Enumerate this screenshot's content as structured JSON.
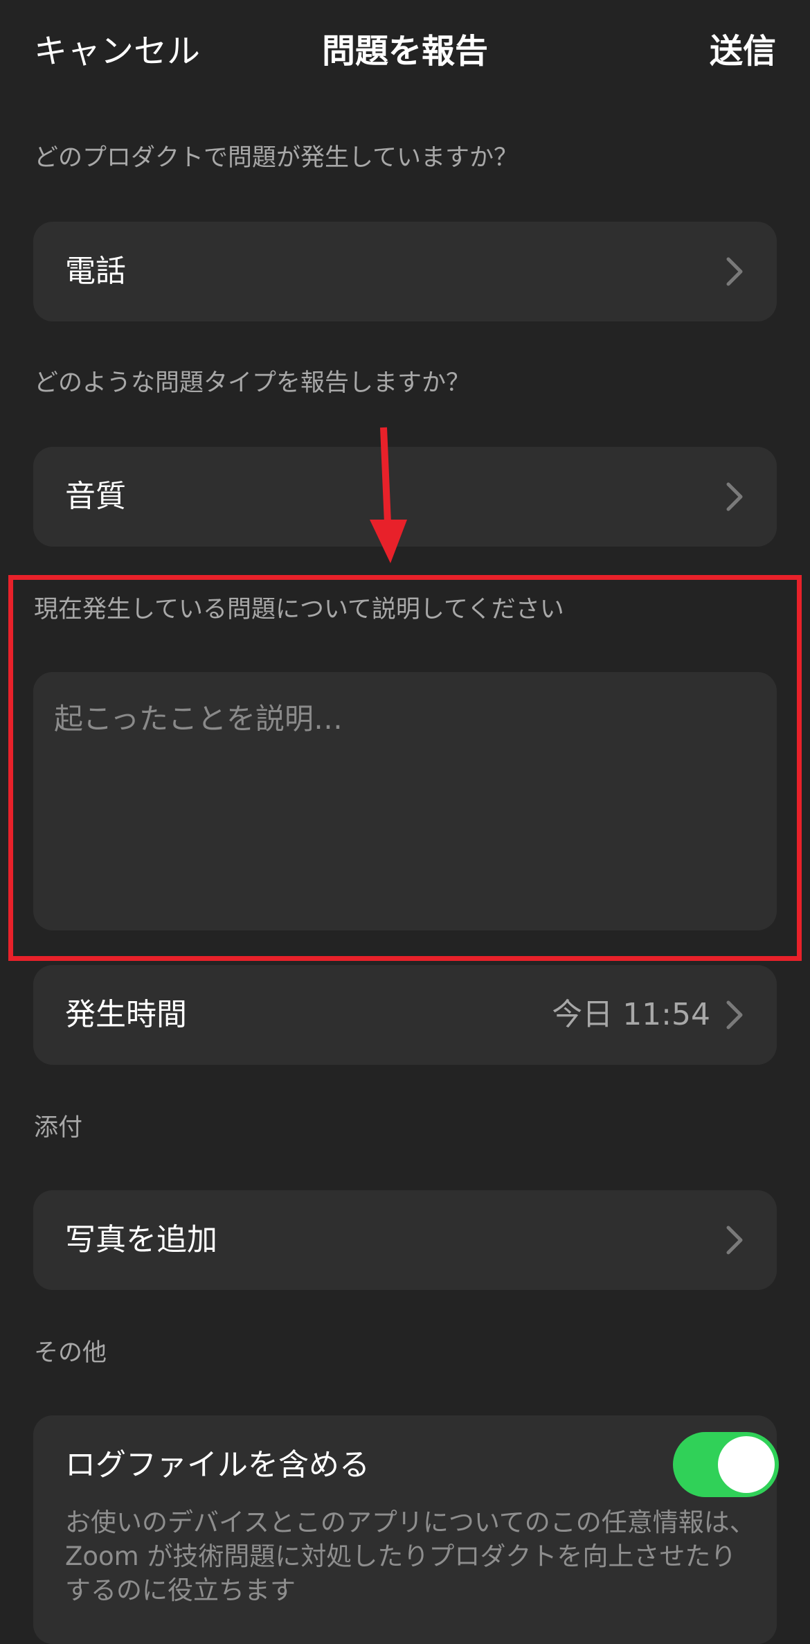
{
  "nav": {
    "cancel": "キャンセル",
    "title": "問題を報告",
    "send": "送信"
  },
  "product_section": {
    "label": "どのプロダクトで問題が発生していますか？",
    "value": "電話"
  },
  "issue_type_section": {
    "label": "どのような問題タイプを報告しますか？",
    "value": "音質"
  },
  "description_section": {
    "label": "現在発生している問題について説明してください",
    "placeholder": "起こったことを説明…"
  },
  "occurrence": {
    "label": "発生時間",
    "value": "今日 11:54"
  },
  "attachments": {
    "label": "添付",
    "add_photo": "写真を追加"
  },
  "other": {
    "label": "その他",
    "include_logs_label": "ログファイルを含める",
    "include_logs_enabled": true,
    "include_logs_desc": "お使いのデバイスとこのアプリについてのこの任意情報は、Zoom が技術問題に対処したりプロダクトを向上させたりするのに役立ちます"
  },
  "colors": {
    "background": "#232323",
    "card": "#2f2f2f",
    "toggle_on": "#30d158",
    "annotation": "#e8212a"
  },
  "icons": {
    "chevron": "chevron-right-icon"
  }
}
